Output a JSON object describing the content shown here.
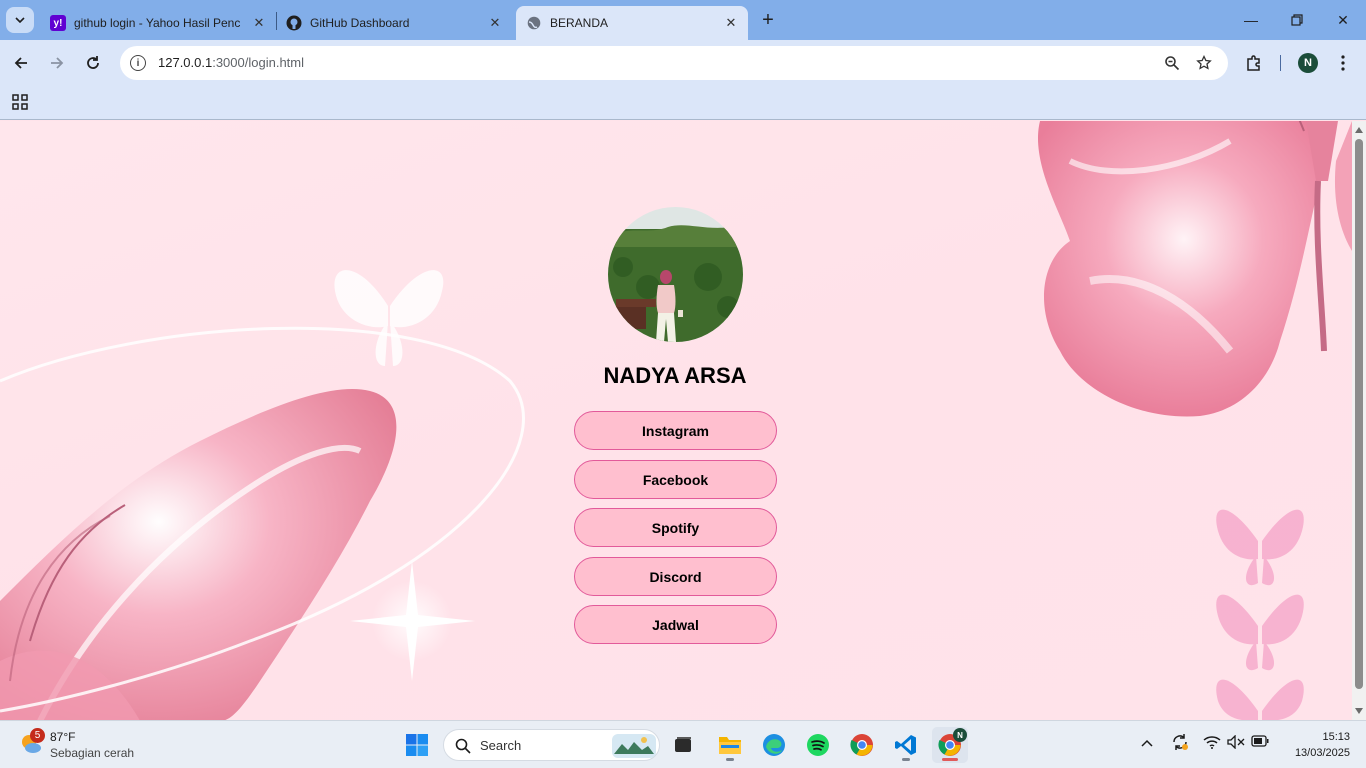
{
  "browser": {
    "tabs": [
      {
        "title": "github login - Yahoo Hasil Penc",
        "favicon": "yahoo-icon",
        "active": false
      },
      {
        "title": "GitHub Dashboard",
        "favicon": "github-icon",
        "active": false
      },
      {
        "title": "BERANDA",
        "favicon": "globe-icon",
        "active": true
      }
    ],
    "url_host": "127.0.0.1",
    "url_path": ":3000/login.html",
    "profile_initial": "N"
  },
  "page": {
    "name": "NADYA ARSA",
    "links": [
      "Instagram",
      "Facebook",
      "Spotify",
      "Discord",
      "Jadwal"
    ],
    "button_color": "#ffbfcf",
    "button_border": "#e25a9a",
    "background": "#ffe3ea"
  },
  "taskbar": {
    "weather_badge": "5",
    "temperature": "87°F",
    "condition": "Sebagian cerah",
    "search_label": "Search",
    "time": "15:13",
    "date": "13/03/2025",
    "chrome_badge": "N"
  }
}
